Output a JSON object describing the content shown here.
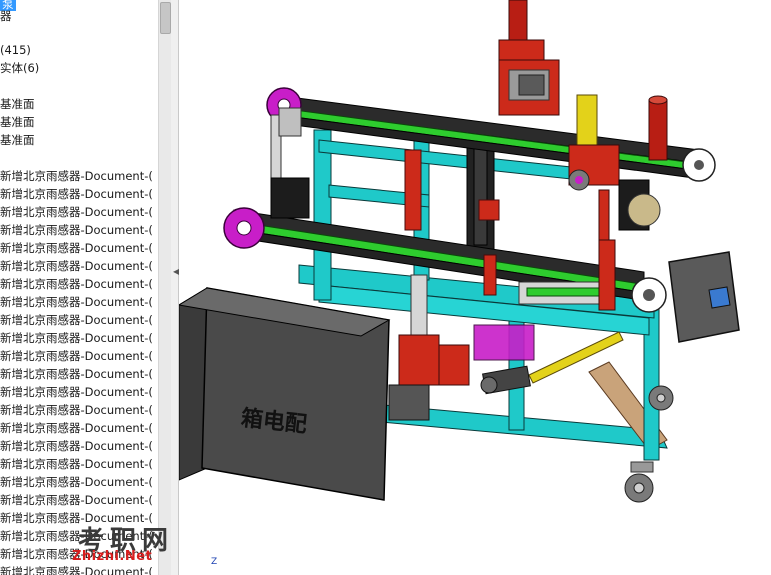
{
  "tree": {
    "items": [
      {
        "label": "泵",
        "selected": true
      },
      {
        "label": "器",
        "selected": false
      },
      {
        "label": "(415)",
        "selected": false
      },
      {
        "label": "实体(6)",
        "selected": false
      },
      {
        "label": "基准面",
        "selected": false
      },
      {
        "label": "基准面",
        "selected": false
      },
      {
        "label": "基准面",
        "selected": false
      },
      {
        "label": "新增北京雨感器-Document-(",
        "selected": false
      },
      {
        "label": "新增北京雨感器-Document-(",
        "selected": false
      },
      {
        "label": "新增北京雨感器-Document-(",
        "selected": false
      },
      {
        "label": "新增北京雨感器-Document-(",
        "selected": false
      },
      {
        "label": "新增北京雨感器-Document-(",
        "selected": false
      },
      {
        "label": "新增北京雨感器-Document-(",
        "selected": false
      },
      {
        "label": "新增北京雨感器-Document-(",
        "selected": false
      },
      {
        "label": "新增北京雨感器-Document-(",
        "selected": false
      },
      {
        "label": "新增北京雨感器-Document-(",
        "selected": false
      },
      {
        "label": "新增北京雨感器-Document-(",
        "selected": false
      },
      {
        "label": "新增北京雨感器-Document-(",
        "selected": false
      },
      {
        "label": "新增北京雨感器-Document-(",
        "selected": false
      },
      {
        "label": "新增北京雨感器-Document-(",
        "selected": false
      },
      {
        "label": "新增北京雨感器-Document-(",
        "selected": false
      },
      {
        "label": "新增北京雨感器-Document-(",
        "selected": false
      },
      {
        "label": "新增北京雨感器-Document-(",
        "selected": false
      },
      {
        "label": "新增北京雨感器-Document-(",
        "selected": false
      },
      {
        "label": "新增北京雨感器-Document-(",
        "selected": false
      },
      {
        "label": "新增北京雨感器-Document-(",
        "selected": false
      },
      {
        "label": "新增北京雨感器-Document-(",
        "selected": false
      },
      {
        "label": "新增北京雨感器-Document-(",
        "selected": false
      },
      {
        "label": "新增北京雨感器-Document-(",
        "selected": false
      },
      {
        "label": "新增北京雨感器-Document-(",
        "selected": false
      },
      {
        "label": "新增北京雨感器-Document-(",
        "selected": false
      },
      {
        "label": "新增北京雨感器-Document-(",
        "selected": false
      },
      {
        "label": "新增北京雨感器-Document-(",
        "selected": false
      },
      {
        "label": "新增北京雨感器-Document-(",
        "selected": false
      }
    ]
  },
  "model": {
    "cabinet_label": "箱电配"
  },
  "watermark": {
    "cn": "考职网",
    "url": "Zhizhi.Net"
  },
  "triad": {
    "z_label": "Z"
  },
  "colors": {
    "frame_cyan": "#1fc9c9",
    "belt_green": "#2ecc2e",
    "part_red": "#cc2a1a",
    "part_magenta": "#c81ec8",
    "cabinet_gray": "#4a4a4a",
    "rod_yellow": "#e3d21a"
  }
}
